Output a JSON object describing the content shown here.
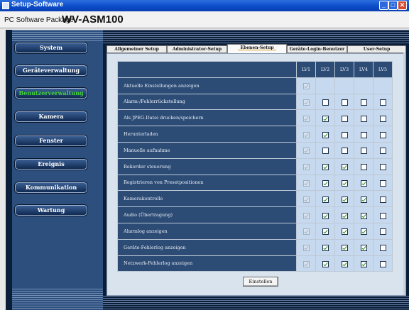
{
  "window": {
    "title": "Setup-Software"
  },
  "package": {
    "label": "PC Software Package",
    "model": "WV-ASM100"
  },
  "sidebar": {
    "items": [
      {
        "label": "System",
        "active": false
      },
      {
        "label": "Geräteverwaltung",
        "active": false
      },
      {
        "label": "Benutzerverwaltung",
        "active": true
      },
      {
        "label": "Kamera",
        "active": false
      },
      {
        "label": "Fenster",
        "active": false
      },
      {
        "label": "Ereignis",
        "active": false
      },
      {
        "label": "Kommunikation",
        "active": false
      },
      {
        "label": "Wartung",
        "active": false
      }
    ],
    "active_color": "#43d33a"
  },
  "tabs": [
    {
      "label": "Allgemeiner Setup",
      "active": false
    },
    {
      "label": "Administrator-Setup",
      "active": false
    },
    {
      "label": "Ebenen-Setup",
      "active": true
    },
    {
      "label": "Geräte-Login-Benutzer",
      "active": false
    },
    {
      "label": "User-Setup",
      "active": false
    }
  ],
  "table": {
    "levels": [
      "LV1",
      "LV2",
      "LV3",
      "LV4",
      "LV5"
    ],
    "rows": [
      {
        "label": "Aktuelle Einstellungen anzeigen",
        "values": [
          "dis-on",
          "blank",
          "blank",
          "blank",
          "blank"
        ]
      },
      {
        "label": "Alarm-/Fehlerrückstellung",
        "values": [
          "dis-on",
          "off",
          "off",
          "off",
          "off"
        ]
      },
      {
        "label": "Als JPEG-Datei drucken/speichern",
        "values": [
          "dis-on",
          "on",
          "off",
          "off",
          "off"
        ]
      },
      {
        "label": "Herunterladen",
        "values": [
          "dis-on",
          "on",
          "off",
          "off",
          "off"
        ]
      },
      {
        "label": "Manuelle aufnahme",
        "values": [
          "dis-on",
          "off",
          "off",
          "off",
          "off"
        ]
      },
      {
        "label": "Rekorder steuerung",
        "values": [
          "dis-on",
          "on",
          "on",
          "off",
          "off"
        ]
      },
      {
        "label": "Registrieren von Presetpositionen",
        "values": [
          "dis-on",
          "on",
          "on",
          "on",
          "off"
        ]
      },
      {
        "label": "Kamerakontrolle",
        "values": [
          "dis-on",
          "on",
          "on",
          "on",
          "off"
        ]
      },
      {
        "label": "Audio (Übertragung)",
        "values": [
          "dis-on",
          "on",
          "on",
          "on",
          "off"
        ]
      },
      {
        "label": "Alarmlog anzeigen",
        "values": [
          "dis-on",
          "on",
          "on",
          "on",
          "off"
        ]
      },
      {
        "label": "Geräte-Fehlerlog anzeigen",
        "values": [
          "dis-on",
          "on",
          "on",
          "on",
          "off"
        ]
      },
      {
        "label": "Netzwerk-Fehlerlog anzeigen",
        "values": [
          "dis-on",
          "on",
          "on",
          "on",
          "off"
        ]
      }
    ]
  },
  "apply_button": {
    "label": "Einstellen"
  }
}
